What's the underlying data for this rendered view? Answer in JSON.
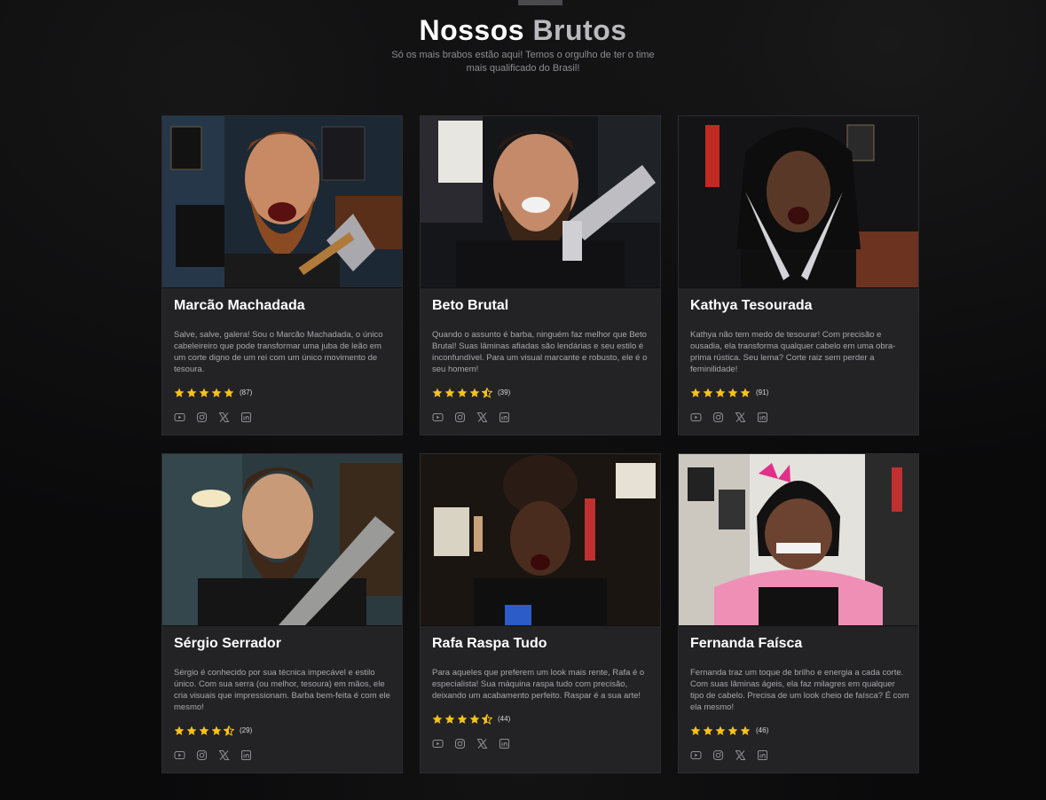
{
  "header": {
    "title_part1": "Nossos",
    "title_part2": "Brutos",
    "subtitle": "Só os mais brabos estão aqui! Temos o orgulho de ter o time mais qualificado do Brasil!"
  },
  "colors": {
    "star": "#f7c21a",
    "card_bg": "#232326",
    "page_bg": "#0a0a0b"
  },
  "barbers": [
    {
      "name": "Marcão Machadada",
      "bio": "Salve, salve, galera! Sou o Marcão Machadada, o único cabeleireiro que pode transformar uma juba de leão em um corte digno de um rei com um único movimento de tesoura.",
      "rating": 5,
      "count": "(87)",
      "photo_icon": "axe-barber-photo"
    },
    {
      "name": "Beto Brutal",
      "bio": "Quando o assunto é barba, ninguém faz melhor que Beto Brutal! Suas lâminas afiadas são lendárias e seu estilo é inconfundível. Para um visual marcante e robusto, ele é o seu homem!",
      "rating": 4.5,
      "count": "(39)",
      "photo_icon": "blade-barber-photo"
    },
    {
      "name": "Kathya Tesourada",
      "bio": "Kathya não tem medo de tesourar! Com precisão e ousadia, ela transforma qualquer cabelo em uma obra-prima rústica. Seu lema? Corte raiz sem perder a feminilidade!",
      "rating": 5,
      "count": "(91)",
      "photo_icon": "scissors-barber-photo"
    },
    {
      "name": "Sérgio Serrador",
      "bio": "Sérgio é conhecido por sua técnica impecável e estilo único. Com sua serra (ou melhor, tesoura) em mãos, ele cria visuais que impressionam. Barba bem-feita é com ele mesmo!",
      "rating": 4.5,
      "count": "(29)",
      "photo_icon": "saw-barber-photo"
    },
    {
      "name": "Rafa Raspa Tudo",
      "bio": "Para aqueles que preferem um look mais rente, Rafa é o especialista! Sua máquina raspa tudo com precisão, deixando um acabamento perfeito. Raspar é a sua arte!",
      "rating": 4.5,
      "count": "(44)",
      "photo_icon": "clipper-barber-photo"
    },
    {
      "name": "Fernanda Faísca",
      "bio": "Fernanda traz um toque de brilho e energia a cada corte. Com suas lâminas ágeis, ela faz milagres em qualquer tipo de cabelo. Precisa de um look cheio de faísca? É com ela mesmo!",
      "rating": 5,
      "count": "(46)",
      "photo_icon": "pink-bow-barber-photo"
    }
  ],
  "social_icons": [
    "youtube-icon",
    "instagram-icon",
    "x-icon",
    "linkedin-icon"
  ]
}
